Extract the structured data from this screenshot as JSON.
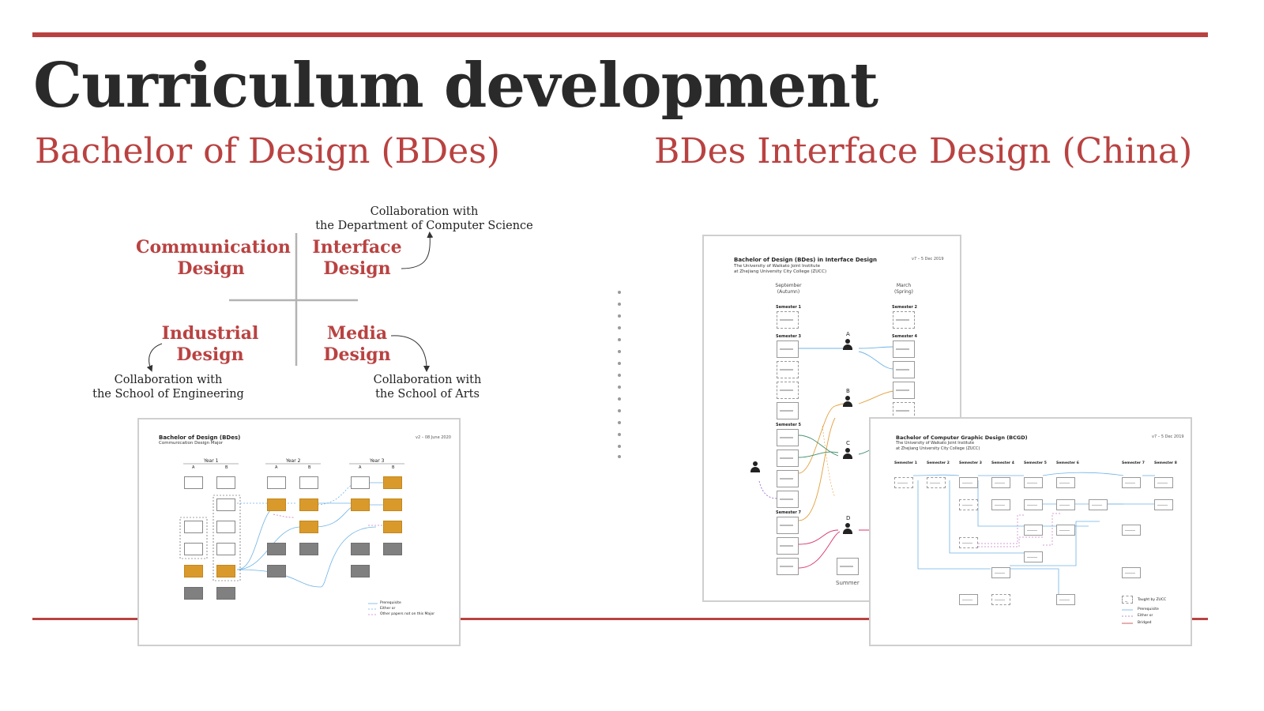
{
  "title": "Curriculum development",
  "subtitle_left": "Bachelor of Design (BDes)",
  "subtitle_right": "BDes Interface Design (China)",
  "colors": {
    "accent": "#b94241",
    "text": "#2a2a2a",
    "orange": "#d99a2b",
    "gray_box": "#808080",
    "blue_line": "#6fb3e6"
  },
  "quadrants": {
    "communication": "Communication\nDesign",
    "interface": "Interface\nDesign",
    "industrial": "Industrial\nDesign",
    "media": "Media\nDesign"
  },
  "collaborations": {
    "computer_science": "Collaboration with\nthe Department of Computer Science",
    "engineering": "Collaboration with\nthe School of Engineering",
    "arts": "Collaboration with\nthe School of Arts"
  },
  "doc_bdes": {
    "title": "Bachelor of Design (BDes)",
    "subtitle": "Communication Design Major",
    "date": "v2 – 08 June 2020",
    "years": [
      "Year 1",
      "Year 2",
      "Year 3"
    ],
    "columns": [
      "A",
      "B"
    ],
    "legend": [
      "Prerequisite",
      "Either or",
      "Other papers not on this Major"
    ]
  },
  "doc_interface": {
    "title": "Bachelor of Design (BDes) in Interface Design",
    "subtitle": "The University of Waikato Joint Institute\nat Zhejiang University City College (ZUCC)",
    "date": "v7 – 5 Dec 2019",
    "col_left": "September\n(Autumn)",
    "col_right": "March\n(Spring)",
    "semesters": [
      "Semester 1",
      "Semester 2",
      "Semester 3",
      "Semester 4",
      "Semester 5",
      "Semester 7"
    ],
    "people": [
      "A",
      "B",
      "C",
      "D"
    ],
    "summer": "Summer"
  },
  "doc_bcgd": {
    "title": "Bachelor of Computer Graphic Design (BCGD)",
    "subtitle": "The University of Waikato Joint Institute\nat Zhejiang University City College (ZUCC)",
    "date": "v7 – 5 Dec 2019",
    "semesters": [
      "Semester 1",
      "Semester 2",
      "Semester 3",
      "Semester 4",
      "Semester 5",
      "Semester 6",
      "Semester 7",
      "Semester 8"
    ],
    "legend": [
      "Taught by ZUCC",
      "Prerequisite",
      "Either or",
      "Bridged"
    ]
  }
}
